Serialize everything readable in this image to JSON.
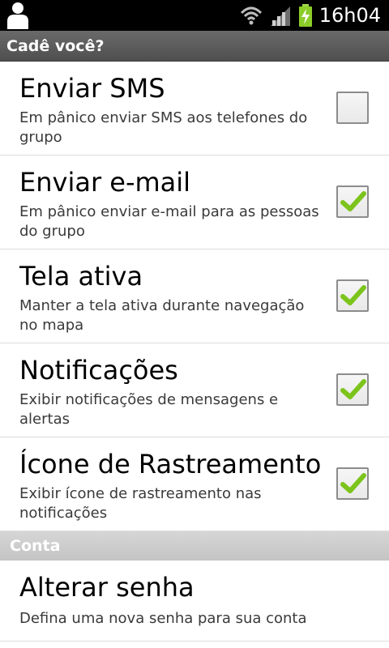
{
  "status_bar": {
    "time": "16h04",
    "icons": [
      "person-icon",
      "wifi-icon",
      "signal-icon",
      "battery-charging-icon"
    ]
  },
  "app_bar": {
    "title": "Cadê você?"
  },
  "settings": [
    {
      "title": "Enviar SMS",
      "summary": "Em pânico enviar SMS aos telefones do grupo",
      "checked": false
    },
    {
      "title": "Enviar e-mail",
      "summary": "Em pânico enviar e-mail para as pessoas do grupo",
      "checked": true
    },
    {
      "title": "Tela ativa",
      "summary": "Manter a tela ativa durante navegação no mapa",
      "checked": true
    },
    {
      "title": "Notificações",
      "summary": "Exibir notificações de mensagens e alertas",
      "checked": true
    },
    {
      "title": "Ícone de Rastreamento",
      "summary": "Exibir ícone de rastreamento nas notificações",
      "checked": true
    }
  ],
  "account_section": {
    "header": "Conta",
    "items": [
      {
        "title": "Alterar senha",
        "summary": "Defina uma nova senha para sua conta"
      }
    ]
  },
  "colors": {
    "check_green": "#7cc41c",
    "status_bar_bg": "#000000",
    "title_bar_bg": "#5c5c5c",
    "section_header_bg": "#cccccc"
  }
}
